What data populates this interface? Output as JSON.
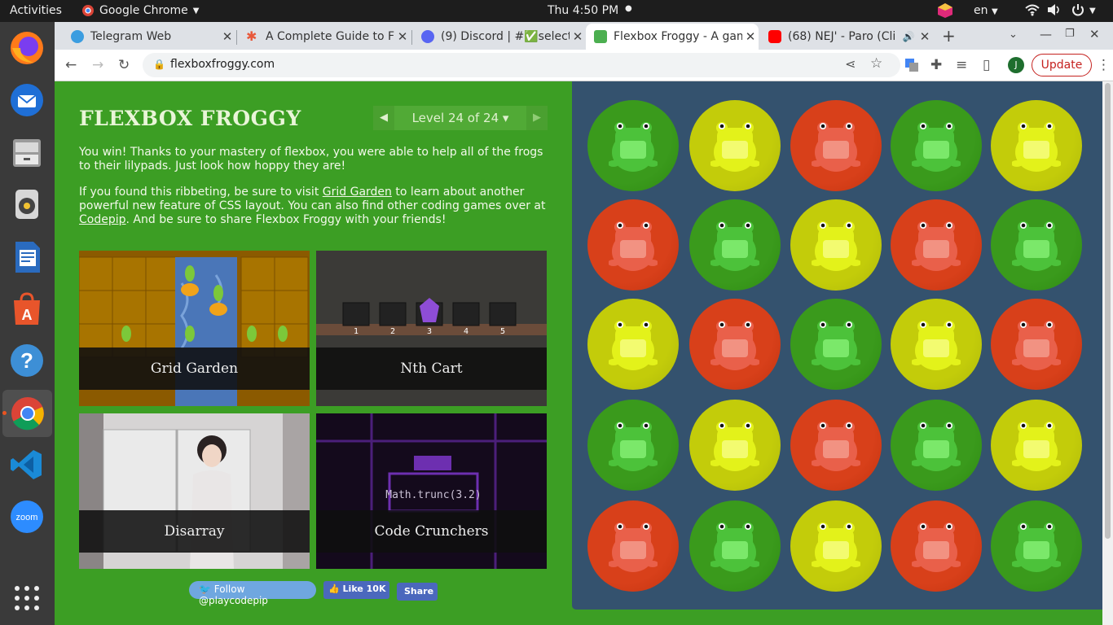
{
  "os": {
    "activities": "Activities",
    "app_name": "Google Chrome",
    "clock": "Thu  4:50 PM",
    "lang": "en"
  },
  "tabs": [
    {
      "title": "Telegram Web",
      "fav": "#3b9de0"
    },
    {
      "title": "A Complete Guide to F",
      "fav": "#e8593b"
    },
    {
      "title": "(9) Discord | #✅select",
      "fav": "#5865f2"
    },
    {
      "title": "Flexbox Froggy - A gam",
      "fav": "#4caf50",
      "active": true
    },
    {
      "title": "(68) NEJ' - Paro (Cli",
      "fav": "#ff0000"
    }
  ],
  "toolbar": {
    "url": "flexboxfroggy.com",
    "update_label": "Update",
    "profile": "J"
  },
  "page": {
    "title": "FLEXBOX FROGGY",
    "level": "Level 24 of 24 ▾",
    "win_text": "You win! Thanks to your mastery of flexbox, you were able to help all of the frogs to their lilypads. Just look how hoppy they are!",
    "p2_pre": "If you found this ribbeting, be sure to visit ",
    "p2_link1": "Grid Garden",
    "p2_mid": " to learn about another powerful new feature of CSS layout. You can also find other coding games over at ",
    "p2_link2": "Codepip",
    "p2_post": ". And be sure to share Flexbox Froggy with your friends!",
    "games": [
      "Grid Garden",
      "Nth Cart",
      "Disarray",
      "Code Crunchers"
    ],
    "cart_numbers": [
      "1",
      "2",
      "3",
      "4",
      "5"
    ],
    "code_text": "Math.trunc(3.2)",
    "follow": "Follow @playcodepip",
    "like": "Like 10K",
    "share": "Share"
  },
  "frogs": [
    [
      "green",
      "yellow",
      "red",
      "green",
      "yellow"
    ],
    [
      "red",
      "green",
      "yellow",
      "red",
      "green"
    ],
    [
      "yellow",
      "red",
      "green",
      "yellow",
      "red"
    ],
    [
      "green",
      "yellow",
      "red",
      "green",
      "yellow"
    ],
    [
      "red",
      "green",
      "yellow",
      "red",
      "green"
    ]
  ],
  "colors": {
    "green": "#3a9a1c",
    "yellow": "#c3cc0a",
    "red": "#d8401a",
    "page_bg": "#3c9e24",
    "pond": "#34526e"
  }
}
